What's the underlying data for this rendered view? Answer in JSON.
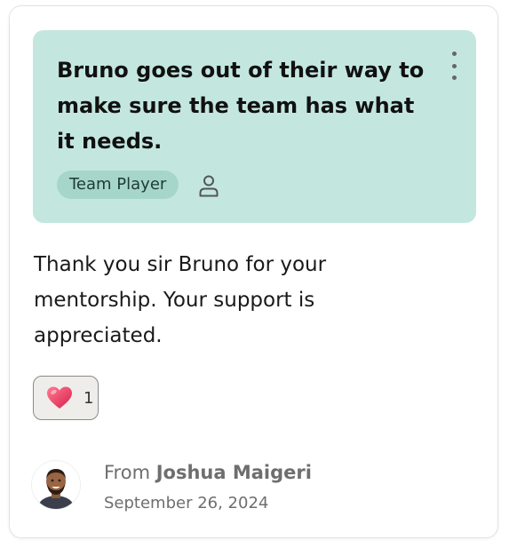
{
  "card": {
    "headline": "Bruno goes out of their way to make sure the team has what it needs.",
    "tag": "Team Player",
    "message": "Thank you sir Bruno for your mentorship. Your support is appreciated.",
    "reaction": {
      "icon": "heart-icon",
      "count": "1"
    },
    "sender": {
      "from_prefix": "From",
      "name": "Joshua Maigeri",
      "date": "September 26, 2024"
    }
  },
  "colors": {
    "highlight_bg": "#c3e7df",
    "tag_bg": "#a6d6c9",
    "reaction_bg": "#efedea",
    "heart": "#e8415b"
  }
}
